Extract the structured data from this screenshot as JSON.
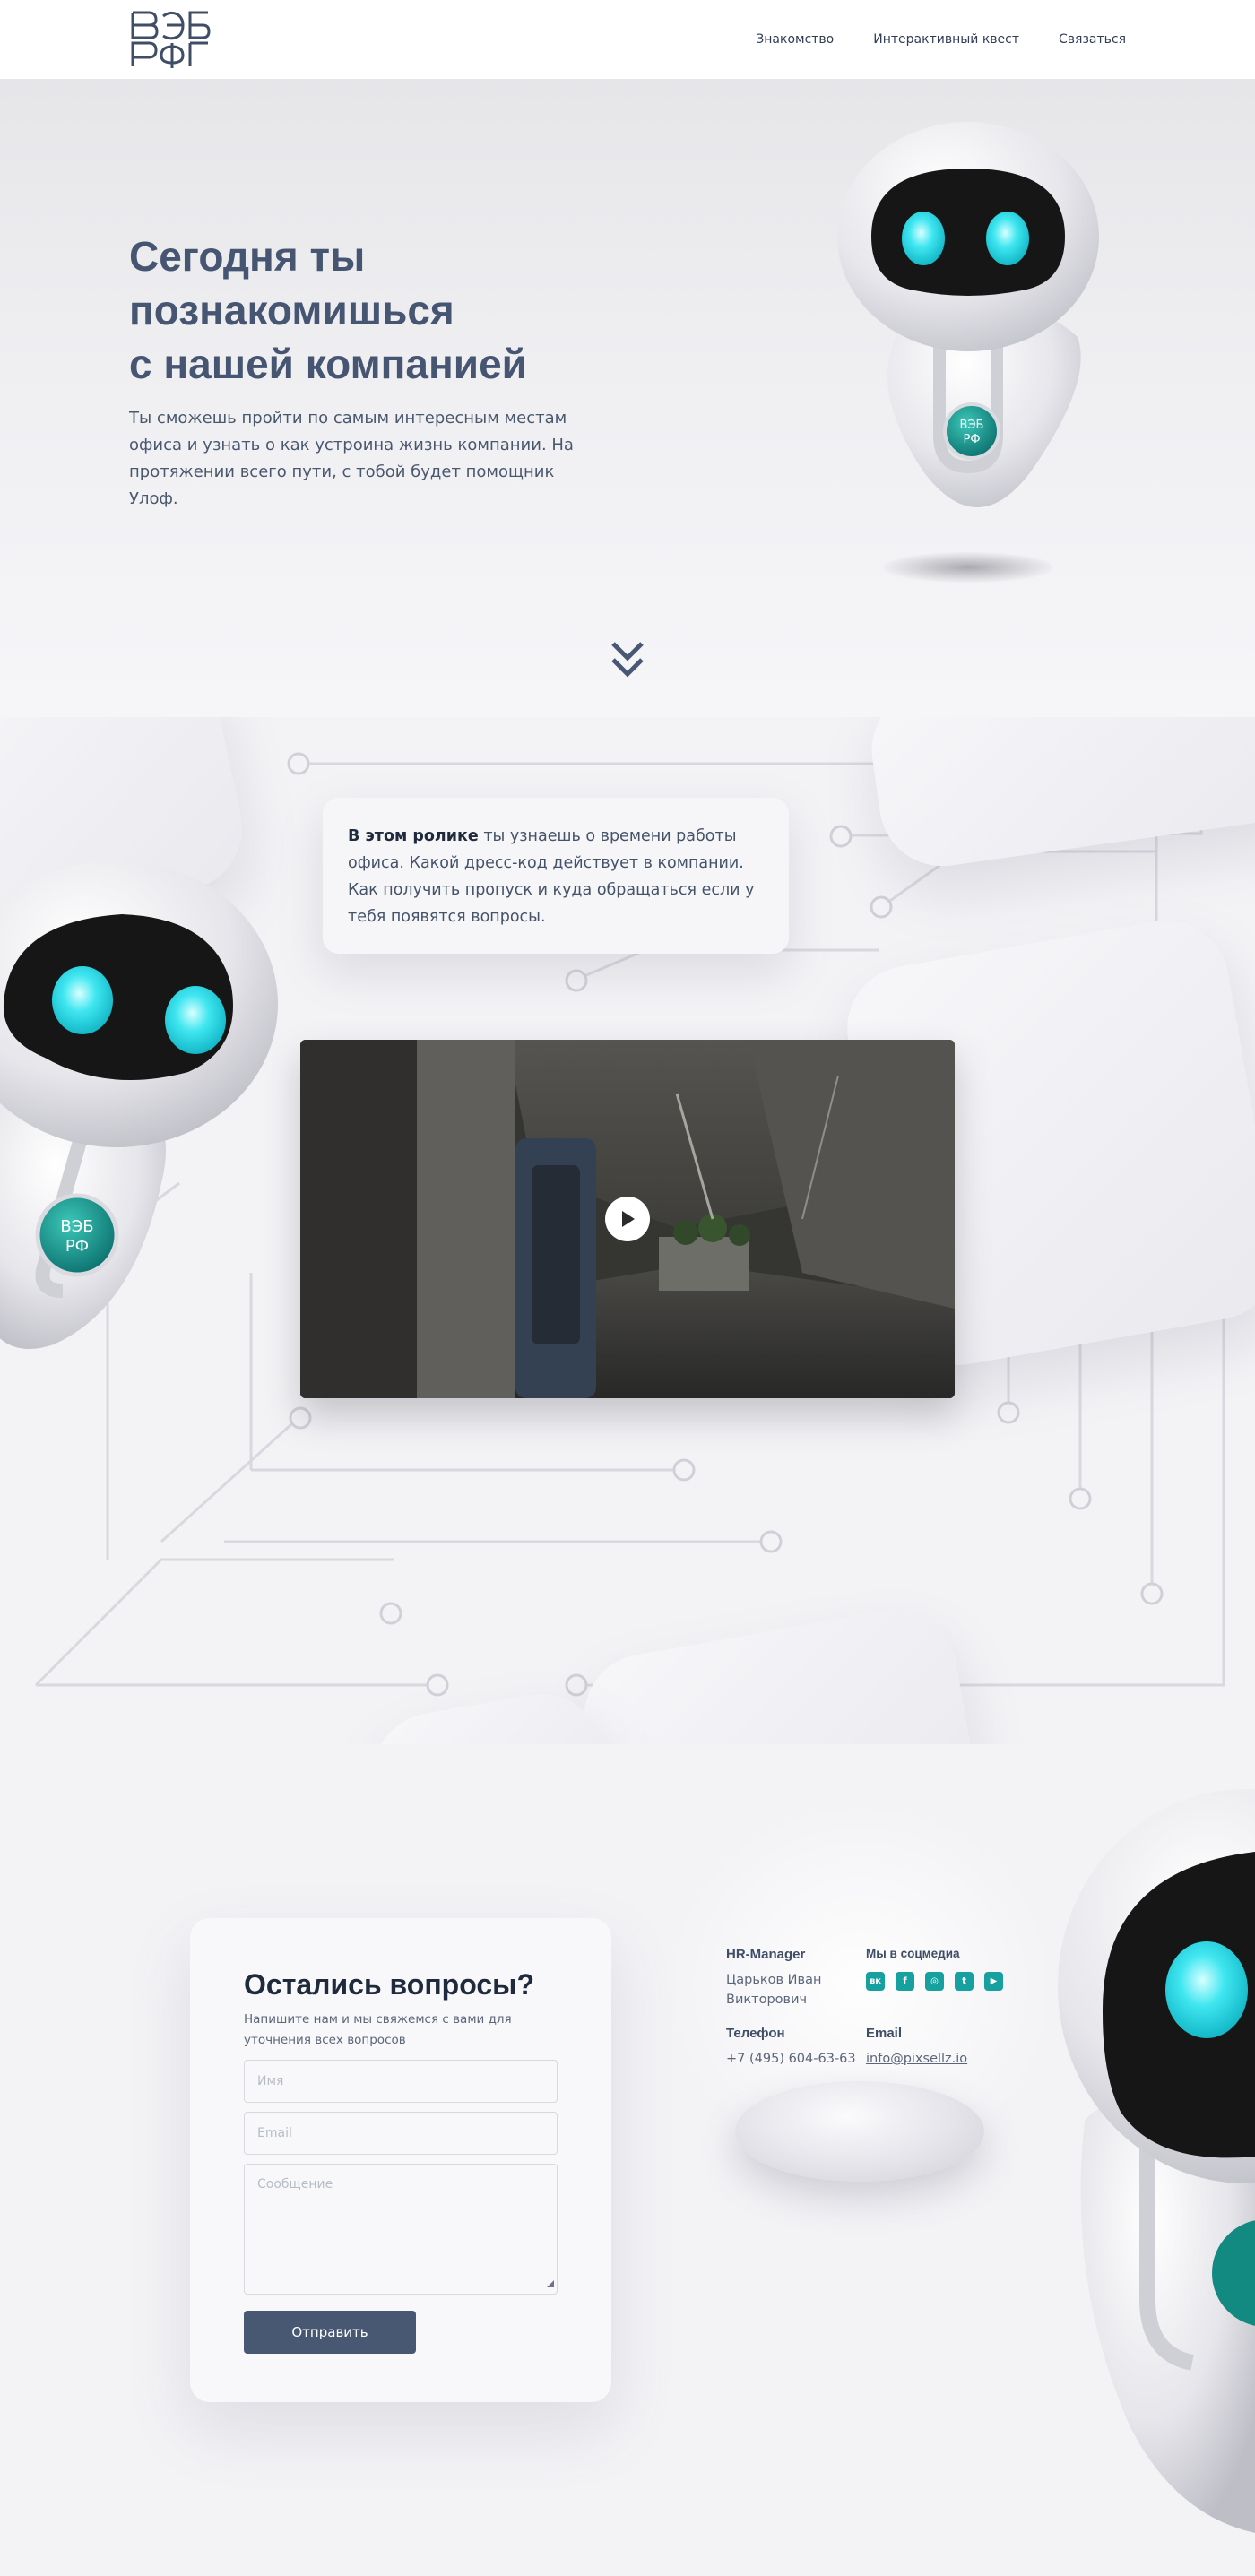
{
  "header": {
    "logo_text": "ВЭБ РФ",
    "nav": [
      {
        "label": "Знакомство"
      },
      {
        "label": "Интерактивный квест"
      },
      {
        "label": "Связаться"
      }
    ]
  },
  "hero": {
    "title_lines": [
      "Сегодня ты",
      "познакомишься",
      "с нашей компанией"
    ],
    "text": "Ты сможешь пройти по самым интересным местам офиса и узнать о как устроина жизнь компании. На протяжении всего пути, с тобой будет помощник Улоф.",
    "scroll_icon": "double-chevron-down-icon"
  },
  "video_section": {
    "callout_bold": "В этом ролике",
    "callout_text": " ты узнаешь о времени работы офиса. Какой дресс-код действует в компании. Как получить пропуск и куда обращаться если у тебя появятся вопросы.",
    "play_icon": "play-icon"
  },
  "contact": {
    "form": {
      "title": "Остались вопросы?",
      "subtitle": "Напишите нам и мы свяжемся с вами для уточнения всех вопросов",
      "name_placeholder": "Имя",
      "email_placeholder": "Email",
      "message_placeholder": "Сообщение",
      "submit_label": "Отправить"
    },
    "info": {
      "manager_label": "HR-Manager",
      "manager_name": "Царьков Иван Викторович",
      "social_label": "Мы в соцмедиа",
      "phone_label": "Телефон",
      "phone": "+7 (495) 604-63-63",
      "email_label": "Email",
      "email": "info@pixsellz.io",
      "socials": [
        {
          "icon": "vk-icon",
          "glyph": "вк"
        },
        {
          "icon": "facebook-icon",
          "glyph": "f"
        },
        {
          "icon": "instagram-icon",
          "glyph": "◎"
        },
        {
          "icon": "twitter-icon",
          "glyph": "t"
        },
        {
          "icon": "youtube-icon",
          "glyph": "▶"
        }
      ]
    }
  },
  "colors": {
    "accent": "#485873",
    "teal": "#17a0a0",
    "eye": "#3fe6f0",
    "text_dark": "#1f2a3c"
  }
}
